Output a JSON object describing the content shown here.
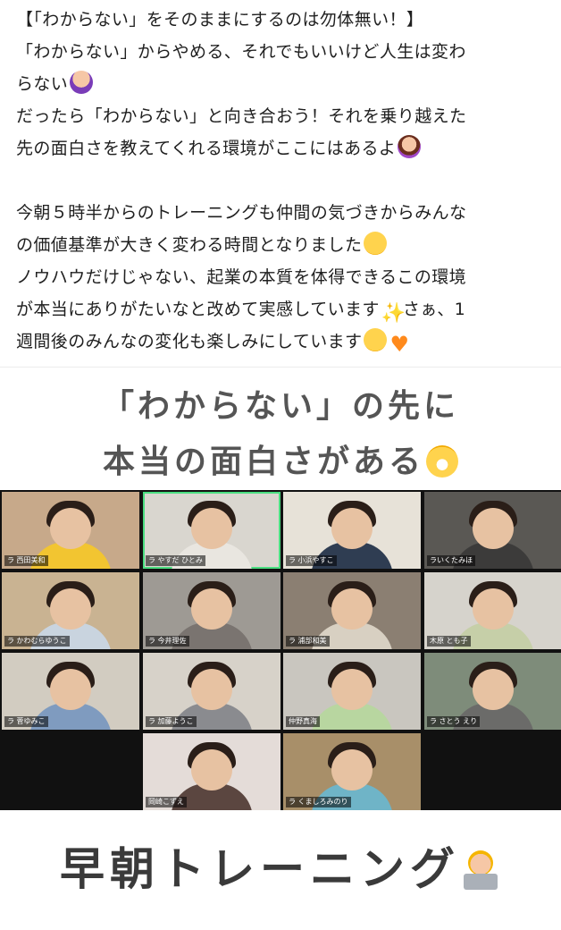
{
  "post": {
    "lines": [
      "【「わからない」をそのままにするのは勿体無い！】",
      "「わからない」からやめる、それでもいいけど人生は変わ",
      "らない",
      "だったら「わからない」と向き合おう！それを乗り越えた",
      "先の面白さを教えてくれる環境がここにはあるよ",
      "今朝５時半からのトレーニングも仲間の気づきからみんな",
      "の価値基準が大きく変わる時間となりました",
      "ノウハウだけじゃない、起業の本質を体得できるこの環境",
      "が本当にありがたいなと改めて実感しています",
      "さぁ、1",
      "週間後のみんなの変化も楽しみにしています"
    ],
    "icons": {
      "cross_arms": "person-gesturing-no-icon",
      "circle_arms": "person-gesturing-ok-icon",
      "smiling": "smiling-face-icon",
      "sparkles": "sparkles-icon",
      "heart": "orange-heart-icon",
      "grin": "grinning-face-icon",
      "laptop": "technologist-icon"
    }
  },
  "image": {
    "caption_line1": "「わからない」の先に",
    "caption_line2": "本当の面白さがある",
    "participants": [
      {
        "name": "ラ 西田美和",
        "bg": "#c7a98a",
        "shirt": "#f2c531"
      },
      {
        "name": "ラ やすだ ひとみ",
        "bg": "#d9d6cf",
        "shirt": "#e9e6e0"
      },
      {
        "name": "ラ 小浜やすこ",
        "bg": "#e7e2d8",
        "shirt": "#2f3d52"
      },
      {
        "name": "ラいくたみほ",
        "bg": "#5a5854",
        "shirt": "#3c3b3a"
      },
      {
        "name": "ラ かわむらゆうこ",
        "bg": "#c9b392",
        "shirt": "#c9d4df"
      },
      {
        "name": "ラ 今井理佐",
        "bg": "#9e9a94",
        "shirt": "#7a7470"
      },
      {
        "name": "ラ 浦部和美",
        "bg": "#8b7f72",
        "shirt": "#d8d0c2"
      },
      {
        "name": "木原 とも子",
        "bg": "#d6d3cc",
        "shirt": "#c6cfa8"
      },
      {
        "name": "ラ 菅ゆみこ",
        "bg": "#d2ccc1",
        "shirt": "#7f9bbf"
      },
      {
        "name": "ラ 加藤ようこ",
        "bg": "#d7d2c9",
        "shirt": "#8a8b8f"
      },
      {
        "name": "仲野真海",
        "bg": "#c9c6bf",
        "shirt": "#b8d6a0"
      },
      {
        "name": "ラ さとう えり",
        "bg": "#7e8c7a",
        "shirt": "#6b6b69"
      },
      {
        "name": "岡崎こずえ",
        "bg": "#e4dcd8",
        "shirt": "#5b4640"
      },
      {
        "name": "ラ くましろみのり",
        "bg": "#a88f69",
        "shirt": "#6fb4c7"
      }
    ],
    "footer": "早朝トレーニング"
  }
}
